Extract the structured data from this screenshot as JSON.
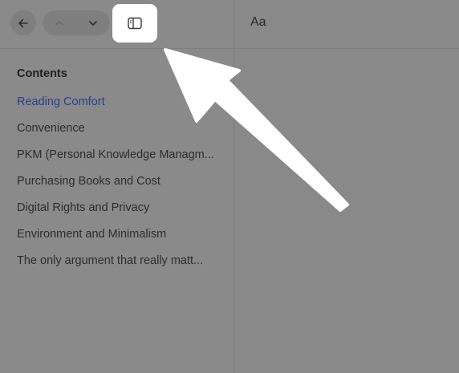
{
  "toolbar": {
    "font_button_label": "Aa"
  },
  "sidebar": {
    "title": "Contents",
    "items": [
      {
        "label": "Reading Comfort",
        "active": true
      },
      {
        "label": "Convenience",
        "active": false
      },
      {
        "label": "PKM (Personal Knowledge Managm...",
        "active": false
      },
      {
        "label": "Purchasing Books and Cost",
        "active": false
      },
      {
        "label": "Digital Rights and Privacy",
        "active": false
      },
      {
        "label": "Environment and Minimalism",
        "active": false
      },
      {
        "label": "The only argument that really matt...",
        "active": false
      }
    ]
  },
  "colors": {
    "active_link": "#2a3f8f",
    "overlay": "#898989",
    "arrow": "#ffffff"
  },
  "icons": {
    "back": "arrow-left-icon",
    "up": "chevron-up-icon",
    "down": "chevron-down-icon",
    "sidebar_toggle": "sidebar-panel-icon",
    "callout": "callout-arrow"
  }
}
